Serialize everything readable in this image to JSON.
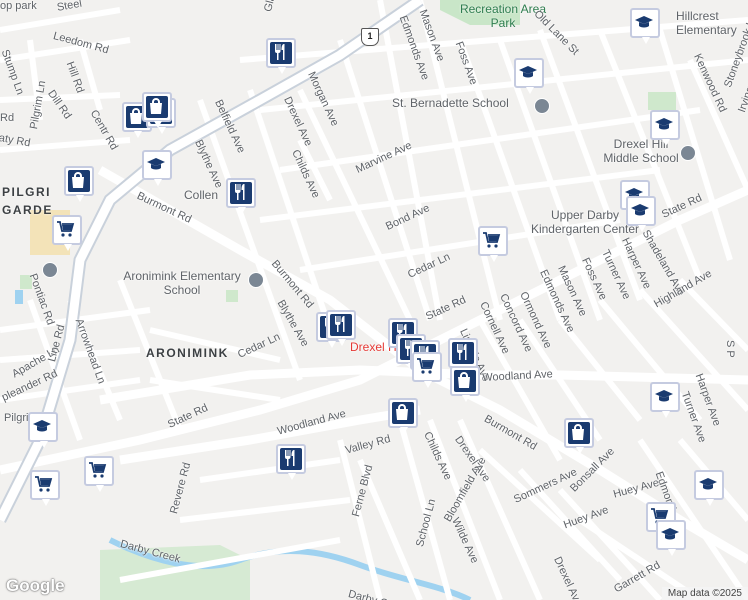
{
  "map": {
    "attribution": "Map data ©2025",
    "logo": "Google",
    "highway_shield": "1",
    "highlight": {
      "name": "Drexel Hill",
      "color": "#e53935"
    },
    "neighborhoods": [
      {
        "key": "aronimink",
        "text": "ARONIMINK"
      },
      {
        "key": "pilgrim-gardens",
        "text": "PILGRI GARDE"
      }
    ],
    "places": [
      {
        "key": "st-bernadette",
        "text": "St. Bernadette School"
      },
      {
        "key": "drexel-hill-middle",
        "text": "Drexel Hill Middle School"
      },
      {
        "key": "upper-darby-kindergarten",
        "text": "Upper Darby Kindergarten Center"
      },
      {
        "key": "aronimink-elementary",
        "text": "Aronimink Elementary School"
      },
      {
        "key": "hillcrest-elementary",
        "text": "Hillcrest Elementary"
      },
      {
        "key": "collen",
        "text": "Collen"
      }
    ],
    "parks": [
      {
        "key": "rec-area",
        "text": "Recreation Area Park"
      }
    ],
    "streets": [
      {
        "key": "gladstone",
        "text": "Gladsto"
      },
      {
        "key": "leedom",
        "text": "Leedom Rd"
      },
      {
        "key": "hill",
        "text": "Hill Rd"
      },
      {
        "key": "dill",
        "text": "Dill Rd"
      },
      {
        "key": "stump",
        "text": "Stump Ln"
      },
      {
        "key": "pilgrim",
        "text": "Pilgrim Ln"
      },
      {
        "key": "central",
        "text": "Centr Rd"
      },
      {
        "key": "rty",
        "text": "aty Rd"
      },
      {
        "key": "belfield",
        "text": "Belfield Ave"
      },
      {
        "key": "blythe-top",
        "text": "Blythe Ave"
      },
      {
        "key": "drexel-top",
        "text": "Drexel Ave"
      },
      {
        "key": "morgan",
        "text": "Morgan Ave"
      },
      {
        "key": "childs-top",
        "text": "Childs Ave"
      },
      {
        "key": "marvine",
        "text": "Marvine Ave"
      },
      {
        "key": "bond",
        "text": "Bond Ave"
      },
      {
        "key": "cedar-top",
        "text": "Cedar Ln"
      },
      {
        "key": "mason-top",
        "text": "Mason Ave"
      },
      {
        "key": "edmonds-top",
        "text": "Edmonds Ave"
      },
      {
        "key": "foss-top",
        "text": "Foss Ave"
      },
      {
        "key": "oldlane",
        "text": "Old Lane St"
      },
      {
        "key": "kenwood",
        "text": "Kenwood Rd"
      },
      {
        "key": "stoneybrook",
        "text": "Stoneybrook Ln"
      },
      {
        "key": "burmont-top",
        "text": "Burmont Rd"
      },
      {
        "key": "burmont-mid",
        "text": "Burmont Rd"
      },
      {
        "key": "pontiac",
        "text": "Pontiac Rd"
      },
      {
        "key": "arrowhead",
        "text": "Arrowhead Ln"
      },
      {
        "key": "apache",
        "text": "Apache Ln"
      },
      {
        "key": "pleander",
        "text": "pleander Rd"
      },
      {
        "key": "pilgrim2",
        "text": "Pilgri"
      },
      {
        "key": "line",
        "text": "Line Rd"
      },
      {
        "key": "blythe-mid",
        "text": "Blythe Ave"
      },
      {
        "key": "cedar-mid",
        "text": "Cedar Ln"
      },
      {
        "key": "state-left",
        "text": "State Rd"
      },
      {
        "key": "woodland-left",
        "text": "Woodland Ave"
      },
      {
        "key": "valley",
        "text": "Valley Rd"
      },
      {
        "key": "revere",
        "text": "Revere Rd"
      },
      {
        "key": "ferne",
        "text": "Ferne Blvd"
      },
      {
        "key": "childs-bot",
        "text": "Childs Ave"
      },
      {
        "key": "bloomfield",
        "text": "Bloomfield Ave"
      },
      {
        "key": "wilde",
        "text": "Wilde Ave"
      },
      {
        "key": "school",
        "text": "School Ln"
      },
      {
        "key": "drexel-mid",
        "text": "Drexel Ave"
      },
      {
        "key": "burmont-bot",
        "text": "Burmont Rd"
      },
      {
        "key": "sommers",
        "text": "Sommers Ave"
      },
      {
        "key": "bonsall",
        "text": "Bonsall Ave"
      },
      {
        "key": "huey-left",
        "text": "Huey Ave"
      },
      {
        "key": "huey-right",
        "text": "Huey Ave"
      },
      {
        "key": "drexel-bot",
        "text": "Drexel Ave"
      },
      {
        "key": "garrett",
        "text": "Garrett Rd"
      },
      {
        "key": "state-mid",
        "text": "State Rd"
      },
      {
        "key": "lindale",
        "text": "Lindale Ave"
      },
      {
        "key": "cornell",
        "text": "Cornell Ave"
      },
      {
        "key": "concord",
        "text": "Concord Ave"
      },
      {
        "key": "ormond",
        "text": "Ormond Ave"
      },
      {
        "key": "edmonds-mid",
        "text": "Edmonds Ave"
      },
      {
        "key": "mason-mid",
        "text": "Mason Ave"
      },
      {
        "key": "foss-mid",
        "text": "Foss Ave"
      },
      {
        "key": "turner",
        "text": "Turner Ave"
      },
      {
        "key": "harper",
        "text": "Harper Ave"
      },
      {
        "key": "state-right",
        "text": "State Rd"
      },
      {
        "key": "shadeland",
        "text": "Shadeland Ave"
      },
      {
        "key": "highland",
        "text": "Highland Ave"
      },
      {
        "key": "woodland-right",
        "text": "Woodland Ave"
      },
      {
        "key": "turner-bot",
        "text": "Turner Ave"
      },
      {
        "key": "harper-bot",
        "text": "Harper Ave"
      },
      {
        "key": "edmonds-bot",
        "text": "Edmond"
      },
      {
        "key": "darby",
        "text": "Darby Creek"
      },
      {
        "key": "darby2",
        "text": "Darby C"
      },
      {
        "key": "steel",
        "text": "Steel"
      },
      {
        "key": "park-top",
        "text": "op park"
      },
      {
        "key": "lrd",
        "text": "Rd"
      },
      {
        "key": "irving",
        "text": "Irving"
      },
      {
        "key": "so",
        "text": "S P"
      }
    ]
  }
}
